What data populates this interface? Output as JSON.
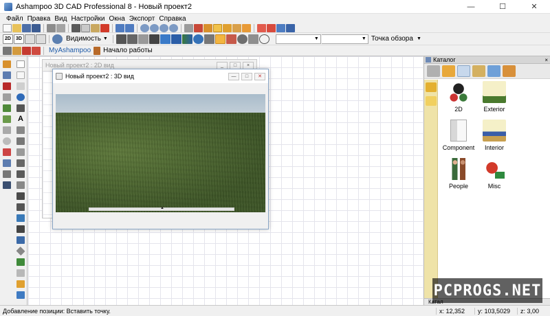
{
  "window": {
    "title": "Ashampoo 3D CAD Professional 8 - Новый проект2",
    "minimize": "—",
    "maximize": "☐",
    "close": "✕"
  },
  "menu": [
    "Файл",
    "Правка",
    "Вид",
    "Настройки",
    "Окна",
    "Экспорт",
    "Справка"
  ],
  "toolbar2": {
    "view_2d": "2D",
    "view_3d": "3D",
    "visibility": "Видимость",
    "viewpoint": "Точка обзора"
  },
  "toolbar3": {
    "myashampoo": "MyAshampoo",
    "getting_started": "Начало работы"
  },
  "windows": {
    "view2d_title": "Новый проект2 : 2D вид",
    "view3d_title": "Новый проект2 : 3D вид"
  },
  "catalog": {
    "header": "Каталог",
    "close": "×",
    "bottom_tab": "Катал",
    "items": [
      {
        "label": "2D",
        "icon": "2d-catalog-icon"
      },
      {
        "label": "Exterior",
        "icon": "exterior-tree-icon"
      },
      {
        "label": "Component",
        "icon": "component-door-icon"
      },
      {
        "label": "Interior",
        "icon": "interior-furniture-icon"
      },
      {
        "label": "People",
        "icon": "people-icon"
      },
      {
        "label": "Misc",
        "icon": "misc-sign-icon"
      }
    ]
  },
  "watermark": "PCPROGS.NET",
  "status": {
    "message": "Добавление позиции: Вставить точку.",
    "x": "x: 12,352",
    "y": "y: 103,5029",
    "z": "z: 3,00"
  },
  "colors": {
    "accent": "#8aa6c6",
    "grass": "#4a632e",
    "sky": "#b4c5d3",
    "catalog_side": "#efe3a8"
  }
}
